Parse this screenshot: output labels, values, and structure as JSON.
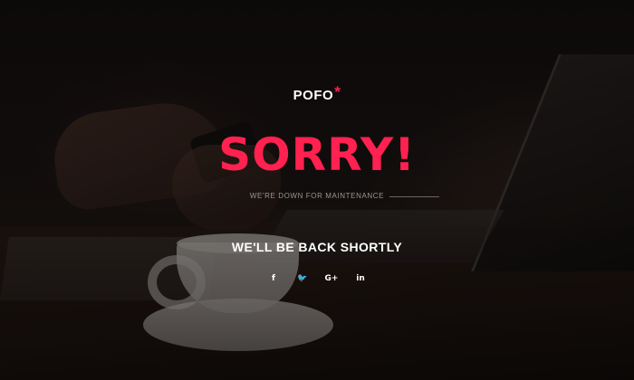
{
  "brand": {
    "name": "POFO",
    "mark": "*",
    "accent_color": "#ff214f"
  },
  "main": {
    "headline": "SORRY!",
    "subtitle": "WE'RE DOWN FOR MAINTENANCE",
    "message": "WE'LL BE BACK SHORTLY"
  },
  "social": [
    {
      "icon": "facebook-icon",
      "glyph": "f"
    },
    {
      "icon": "twitter-icon",
      "glyph": "🐦"
    },
    {
      "icon": "google-plus-icon",
      "glyph": "G+"
    },
    {
      "icon": "linkedin-icon",
      "glyph": "in"
    }
  ]
}
